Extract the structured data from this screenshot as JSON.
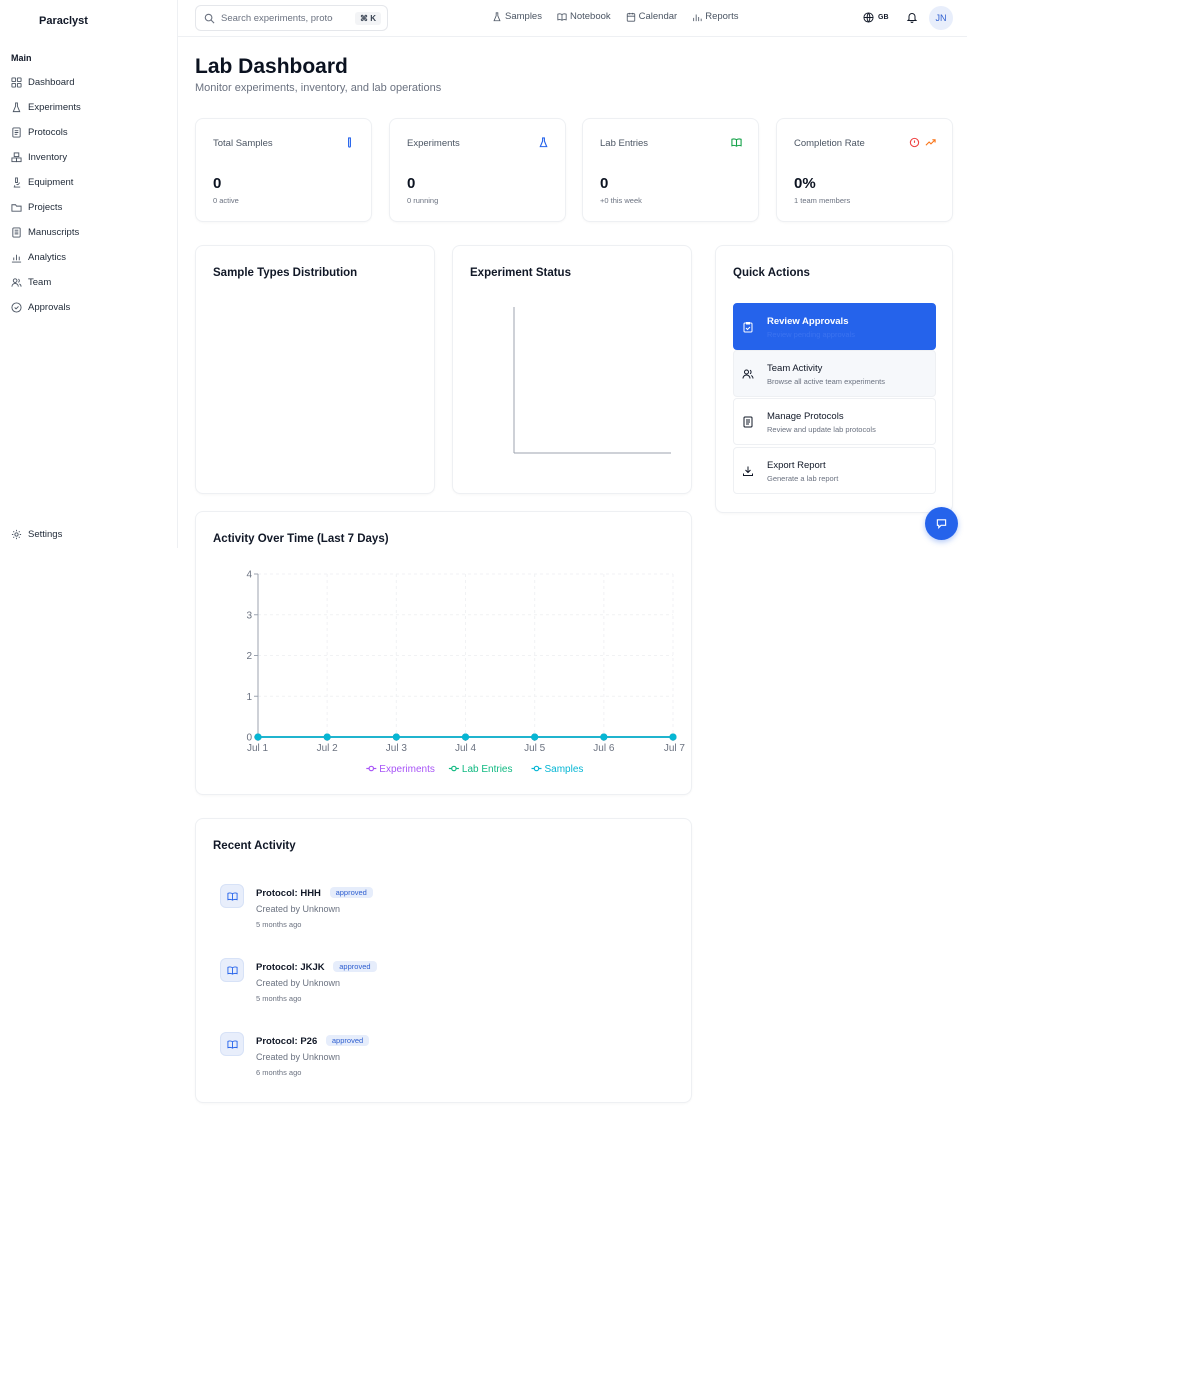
{
  "app": {
    "brand": "Paraclyst"
  },
  "sidebar": {
    "section": "Main",
    "items": [
      {
        "label": "Dashboard",
        "icon": "grid-icon",
        "active": true
      },
      {
        "label": "Experiments",
        "icon": "flask-icon"
      },
      {
        "label": "Protocols",
        "icon": "document-icon"
      },
      {
        "label": "Inventory",
        "icon": "boxes-icon"
      },
      {
        "label": "Equipment",
        "icon": "microscope-icon"
      },
      {
        "label": "Projects",
        "icon": "folder-icon"
      },
      {
        "label": "Manuscripts",
        "icon": "manuscript-icon"
      },
      {
        "label": "Analytics",
        "icon": "bar-chart-icon"
      },
      {
        "label": "Team",
        "icon": "users-icon"
      },
      {
        "label": "Approvals",
        "icon": "check-circle-icon"
      }
    ],
    "settings": "Settings"
  },
  "topbar": {
    "search_placeholder": "Search experiments, protocols...",
    "shortcut": "⌘ K",
    "links": [
      {
        "label": "Samples",
        "icon": "flask-icon"
      },
      {
        "label": "Notebook",
        "icon": "book-icon"
      },
      {
        "label": "Calendar",
        "icon": "calendar-icon"
      },
      {
        "label": "Reports",
        "icon": "bar-chart-icon"
      }
    ],
    "language": "GB",
    "avatar_initials": "JN"
  },
  "header": {
    "title": "Lab Dashboard",
    "subtitle": "Monitor experiments, inventory, and lab operations"
  },
  "stats": [
    {
      "label": "Total Samples",
      "value": "0",
      "sub": "0 active",
      "icon": "test-tube-icon",
      "color": "#2563eb"
    },
    {
      "label": "Experiments",
      "value": "0",
      "sub": "0 running",
      "icon": "flask-icon",
      "color": "#2563eb"
    },
    {
      "label": "Lab Entries",
      "value": "0",
      "sub": "+0 this week",
      "icon": "book-icon",
      "color": "#16a34a"
    },
    {
      "label": "Completion Rate",
      "value": "0%",
      "sub": "1 team members",
      "icon": "trending-up-icon",
      "color": "#f97316"
    }
  ],
  "panels": {
    "sample_types": "Sample Types Distribution",
    "experiment_status": "Experiment Status",
    "quick_actions": "Quick Actions",
    "activity": "Activity Over Time (Last 7 Days)",
    "recent": "Recent Activity"
  },
  "quick_actions": [
    {
      "title": "Review Approvals",
      "desc": "Review pending approvals",
      "icon": "clipboard-check-icon"
    },
    {
      "title": "Team Activity",
      "desc": "Browse all active team experiments",
      "icon": "users-icon"
    },
    {
      "title": "Manage Protocols",
      "desc": "Review and update lab protocols",
      "icon": "document-icon"
    },
    {
      "title": "Export Report",
      "desc": "Generate a lab report",
      "icon": "download-icon"
    }
  ],
  "recent_activity": [
    {
      "title": "Protocol: HHH",
      "status": "approved",
      "by": "Created by Unknown",
      "time": "5 months ago"
    },
    {
      "title": "Protocol: JKJK",
      "status": "approved",
      "by": "Created by Unknown",
      "time": "5 months ago"
    },
    {
      "title": "Protocol: P26",
      "status": "approved",
      "by": "Created by Unknown",
      "time": "6 months ago"
    }
  ],
  "colors": {
    "accent": "#2563eb",
    "experiments": "#a855f7",
    "lab_entries": "#10b981",
    "samples": "#06b6d4"
  },
  "chart_data": [
    {
      "type": "line",
      "title": "Activity Over Time (Last 7 Days)",
      "categories": [
        "Jul 1",
        "Jul 2",
        "Jul 3",
        "Jul 4",
        "Jul 5",
        "Jul 6",
        "Jul 7"
      ],
      "series": [
        {
          "name": "Experiments",
          "values": [
            0,
            0,
            0,
            0,
            0,
            0,
            0
          ],
          "color": "#a855f7"
        },
        {
          "name": "Lab Entries",
          "values": [
            0,
            0,
            0,
            0,
            0,
            0,
            0
          ],
          "color": "#10b981"
        },
        {
          "name": "Samples",
          "values": [
            0,
            0,
            0,
            0,
            0,
            0,
            0
          ],
          "color": "#06b6d4"
        }
      ],
      "yticks": [
        0,
        1,
        2,
        3,
        4
      ],
      "ylim": [
        0,
        4
      ],
      "grid": true,
      "legend": "bottom"
    }
  ]
}
